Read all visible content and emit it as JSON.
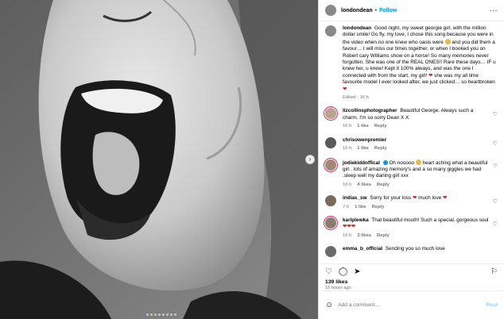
{
  "header": {
    "username": "londondean",
    "separator": "•",
    "follow_label": "Follow",
    "more_label": "···"
  },
  "caption": {
    "username": "londondean",
    "text": "Good night, my sweet georgie girl, with the million dollar smile! Go fly, my love, I chose this song because you were in the video when no one knew who oasis were",
    "text2": "and you did them a favour… I will miss our times together, or when I booked you on Robert cary Williams show on a horse! So many memories never forgotten. She was one of the REAL ONES!! Rare these days… IF u knew her, u knew! Kept it 100% always, and was the one I connected with from the start, my girl!",
    "text3": "she was my all time favourite model I ever looked after, we just clicked… so heartbroken",
    "edited": "Edited · 16 h"
  },
  "comments": [
    {
      "username": "lizcollinsphotographer",
      "text": "Beautiful George. Always such a charm. I'm so sorry Dean X X",
      "time": "16 h",
      "likes": "1 like",
      "reply": "Reply"
    },
    {
      "username": "chrisowenpremier",
      "text": "",
      "time": "16 h",
      "likes": "1 like",
      "reply": "Reply"
    },
    {
      "username": "jodiekiddoffical",
      "text": "Oh nooooo",
      "text2": "heart aching what a beautiful girl . lots of amazing memory's and a so many giggles we had .sleep well my darling girl xxx",
      "time": "16 h",
      "likes": "4 likes",
      "reply": "Reply"
    },
    {
      "username": "indias_sw",
      "text": "Sorry for your loss",
      "text2": "much love",
      "time": "7 h",
      "likes": "1 like",
      "reply": "Reply"
    },
    {
      "username": "karlplewka",
      "text": "That beautiful mouth! Such a special, gorgeous soul",
      "time": "16 h",
      "likes": "3 likes",
      "reply": "Reply"
    },
    {
      "username": "emma_b_official",
      "text": "Sending you so much love",
      "time": "",
      "likes": "",
      "reply": ""
    }
  ],
  "stats": {
    "likes": "139 likes",
    "time_ago": "16 hours ago"
  },
  "add_comment": {
    "placeholder": "Add a comment…",
    "post_label": "Post"
  },
  "carousel": {
    "dot_count": 9,
    "active_index": 0
  },
  "colors": {
    "follow": "#0095f6",
    "story_ring": "#d62976",
    "heart_red": "#d81e2c"
  }
}
